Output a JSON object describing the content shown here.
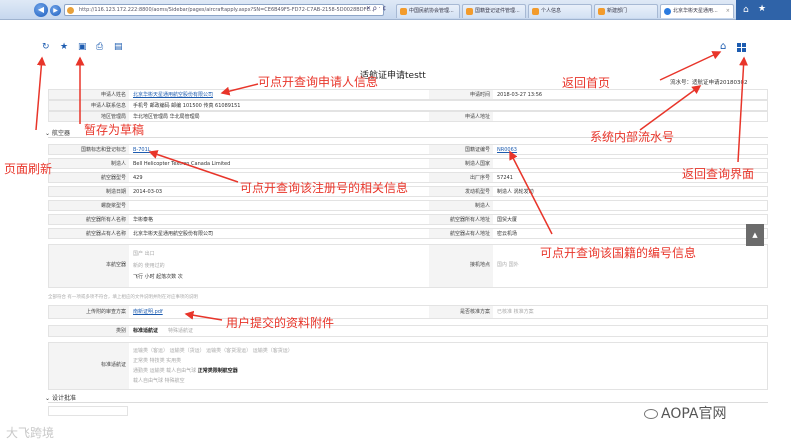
{
  "browser": {
    "address": "http://116.123.172.222:8800/aoms/Sidebar/pages/aircraftapply.aspx?SN=CE6B49F5-FD72-C7AB-2158-5D0028BDFC...",
    "tools": "✕ ρ · ¢",
    "tabs": [
      {
        "label": "中国民航协会管理..."
      },
      {
        "label": "国籍登记证件管理..."
      },
      {
        "label": "个人信息"
      },
      {
        "label": "新建部门"
      },
      {
        "label": "北京华彬天星通用..."
      }
    ]
  },
  "page": {
    "title": "适航证申请testt",
    "serial": "流水号：适航证申请20180302"
  },
  "applicant": {
    "rows": [
      {
        "label": "申请人姓名",
        "value": "北京华彬天星通用航空股份有限公司",
        "link": true,
        "label2": "申请时间",
        "value2": "2018-03-27 13:56"
      },
      {
        "label": "申请人联系信息",
        "value": "手机号 邮政编码 邮编 101500 传真 61089151",
        "link": false,
        "label2": "",
        "value2": ""
      },
      {
        "label": "地区管理局",
        "value": "华北地区管理局 华北局管理局",
        "link": false,
        "label2": "申请人地址",
        "value2": ""
      }
    ]
  },
  "aircraft_section": {
    "title": "航空器",
    "rows": [
      {
        "label": "国籍标志和登记标志",
        "value": "B-701L",
        "link": true,
        "label2": "国籍证编号",
        "value2": "NR0063",
        "link2": true
      },
      {
        "label": "制造人",
        "value": "Bell Helicopter Textron Canada Limited",
        "link": false,
        "label2": "制造人国家",
        "value2": "",
        "link2": false
      },
      {
        "label": "航空器型号",
        "value": "429",
        "link": false,
        "label2": "出厂序号",
        "value2": "57241",
        "link2": false
      },
      {
        "label": "制造日期",
        "value": "2014-03-03",
        "link": false,
        "label2": "发动机型号",
        "value2": "制造人 涡轮发动",
        "link2": false
      },
      {
        "label": "螺旋桨型号",
        "value": "",
        "link": false,
        "label2": "制造人",
        "value2": "",
        "link2": false
      },
      {
        "label": "航空器所有人名称",
        "value": "华彬泰格",
        "link": false,
        "label2": "航空器所有人地址",
        "value2": "国贸大厦",
        "link2": false
      },
      {
        "label": "航空器占有人名称",
        "value": "北京华彬天星通用航空股份有限公司",
        "link": false,
        "label2": "航空器占有人地址",
        "value2": "密云机场",
        "link2": false
      }
    ],
    "aircraft_status": {
      "label": "本航空器",
      "line1": "国产 出口",
      "line2": "新的 使用过的",
      "line3": "飞行 小时 起落次数 次",
      "label2": "接机地点",
      "value2": "国内 国外"
    }
  },
  "notes_row": "全部符合 有一项或多项不符合，填上相应的文件说明并附在对应事项的说明",
  "attachments": {
    "label": "上传附的审查方案",
    "file": "南新证明.pdf",
    "label2": "是否核准方案",
    "value2": "已核准 核准方案"
  },
  "category": {
    "label": "类别",
    "value": "标准适航证",
    "extra": "特殊适航证"
  },
  "standard_cert": {
    "label": "标准适航证",
    "line1": "运输类（客运） 运输类（货运） 运输类（客货混运） 运输类（客货运）",
    "line2": "正常类 特技类 实用类",
    "line3a": "通勤类 运输类 载人自由气球 ",
    "line3b": "正常类限制航空器",
    "line4": "载人自由气球 特殊航空"
  },
  "design_section": {
    "title": "设计批准"
  },
  "annotations": {
    "query_applicant": "可点开查询申请人信息",
    "save_draft": "暂存为草稿",
    "refresh": "页面刷新",
    "home": "返回首页",
    "serial": "系统内部流水号",
    "back_query": "返回查询界面",
    "query_reg": "可点开查询该注册号的相关信息",
    "query_nat": "可点开查询该国籍的编号信息",
    "attach": "用户提交的资料附件"
  },
  "watermarks": {
    "left": "大飞跨境",
    "right": "AOPA官网"
  },
  "colors": {
    "annotation": "#e8352a",
    "link": "#1d5cb0",
    "chrome": "#c6d7ee"
  }
}
